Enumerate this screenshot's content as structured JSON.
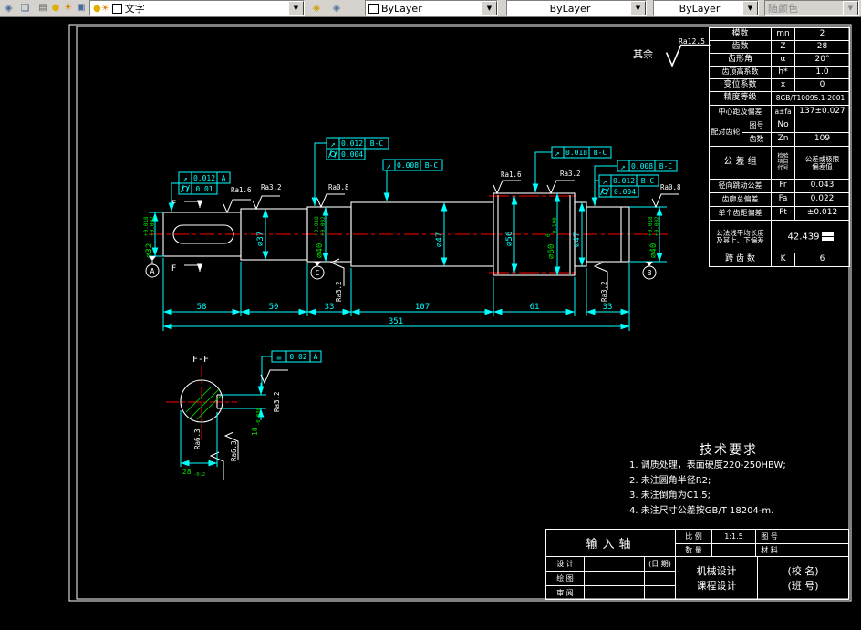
{
  "toolbar": {
    "layer_value": "文字",
    "color_value": "ByLayer",
    "linetype_value": "ByLayer",
    "lineweight_value": "ByLayer",
    "plot_style_value": "随颜色"
  },
  "gear_table": {
    "module": {
      "label": "模数",
      "sym": "mn",
      "val": "2"
    },
    "teeth": {
      "label": "齿数",
      "sym": "Z",
      "val": "28"
    },
    "pressure_angle": {
      "label": "齿形角",
      "sym": "α",
      "val": "20°"
    },
    "addendum_coef": {
      "label": "齿顶高系数",
      "sym": "h*",
      "val": "1.0"
    },
    "shift_coef": {
      "label": "变位系数",
      "sym": "x",
      "val": "0"
    },
    "accuracy": {
      "label": "精度等级",
      "val": "8GB/T10095.1-2001"
    },
    "center_dist": {
      "label": "中心距及偏差",
      "sym": "a±fa",
      "val": "137±0.027"
    },
    "mating": {
      "label": "配对齿轮",
      "row1_label": "图号",
      "row1_sym": "No",
      "row1_val": "",
      "row2_label": "齿数",
      "row2_sym": "Zn",
      "row2_val": "109"
    },
    "tol_group": {
      "label": "公 差 组",
      "sym_l1": "检验",
      "sym_l2": "项目",
      "sym_l3": "代号",
      "val_l1": "公差或极限",
      "val_l2": "偏差值"
    },
    "runout_tol": {
      "label": "径向跳动公差",
      "sym": "Fr",
      "val": "0.043"
    },
    "profile_dev": {
      "label": "齿廓总偏差",
      "sym": "Fa",
      "val": "0.022"
    },
    "pitch_dev": {
      "label": "单个齿距偏差",
      "sym": "Ft",
      "val": "±0.012"
    },
    "normal_length": {
      "label_l1": "公法线平均长度",
      "label_l2": "及其上、下偏差",
      "val": "42.439"
    },
    "span_teeth": {
      "label": "跨 齿 数",
      "sym": "K",
      "val": "6"
    }
  },
  "drawing": {
    "general_roughness": {
      "prefix": "其余",
      "value": "Ra12.5"
    },
    "section_title": "F-F",
    "section_mark": "F",
    "datums": {
      "a": "A",
      "b": "B",
      "c": "C"
    },
    "lengths": {
      "seg1": "58",
      "seg2": "50",
      "seg3": "33",
      "seg4": "107",
      "seg5": "61",
      "seg6": "33",
      "total": "351"
    },
    "diameters": {
      "d32": {
        "main": "⌀32",
        "sup": "+0.018",
        "sub": "+0.002"
      },
      "d37": "⌀37",
      "d40_left": {
        "main": "⌀40",
        "sup": "+0.018",
        "sub": "+0.002"
      },
      "d47_mid": "⌀47",
      "d56": "⌀56",
      "d60": {
        "main": "⌀60",
        "sup": "0",
        "sub": "-0.190"
      },
      "d47_right": "⌀47",
      "d40_right": {
        "main": "⌀40",
        "sup": "+0.018",
        "sub": "+0.002"
      }
    },
    "keyway": {
      "width": {
        "main": "10",
        "sub": "-0.036"
      },
      "depth": {
        "main": "28",
        "sub": "-0.2"
      }
    },
    "fcf": {
      "left_runout": {
        "val": "0.012",
        "ref": "A"
      },
      "left_cyl": {
        "val": "0.01"
      },
      "j1_runout": {
        "val": "0.012",
        "ref": "B-C"
      },
      "j1_cyl": {
        "val": "0.004"
      },
      "mid_runout": {
        "val": "0.008",
        "ref": "B-C"
      },
      "gear_runout": {
        "val": "0.018",
        "ref": "B-C"
      },
      "j2_runout": {
        "val": "0.008",
        "ref": "B-C"
      },
      "j2b_runout": {
        "val": "0.012",
        "ref": "B-C"
      },
      "j2_cyl": {
        "val": "0.004"
      },
      "key_sym": {
        "val": "0.02",
        "ref": "A"
      }
    },
    "roughness": {
      "ra1": "Ra1.6",
      "ra2": "Ra3.2",
      "ra3": "Ra0.8",
      "ra4": "Ra1.6",
      "ra5": "Ra3.2",
      "ra6": "Ra0.8",
      "ra7": "Ra3.2",
      "ra8": "Ra3.2",
      "ra9": "Ra3.2",
      "ra10": "Ra6.3",
      "ra11": "Ra6.3"
    }
  },
  "tech_req": {
    "title": "技术要求",
    "item1": "1. 调质处理，表面硬度220-250HBW;",
    "item2": "2. 未注圆角半径R2;",
    "item3": "3. 未注倒角为C1.5;",
    "item4": "4. 未注尺寸公差按GB/T 18204-m."
  },
  "title_block": {
    "part_name": "输入轴",
    "scale_label": "比 例",
    "scale_val": "1:1.5",
    "qty_label": "数 量",
    "qty_val": "",
    "no_label": "图 号",
    "no_val": "",
    "mat_label": "材 料",
    "mat_val": "",
    "design_label": "设 计",
    "date_label": "(日 期)",
    "draft_label": "绘 图",
    "review_label": "审 阅",
    "org_l1": "机械设计",
    "org_l2": "课程设计",
    "school_l1": "(校 名)",
    "school_l2": "(班 号)"
  }
}
